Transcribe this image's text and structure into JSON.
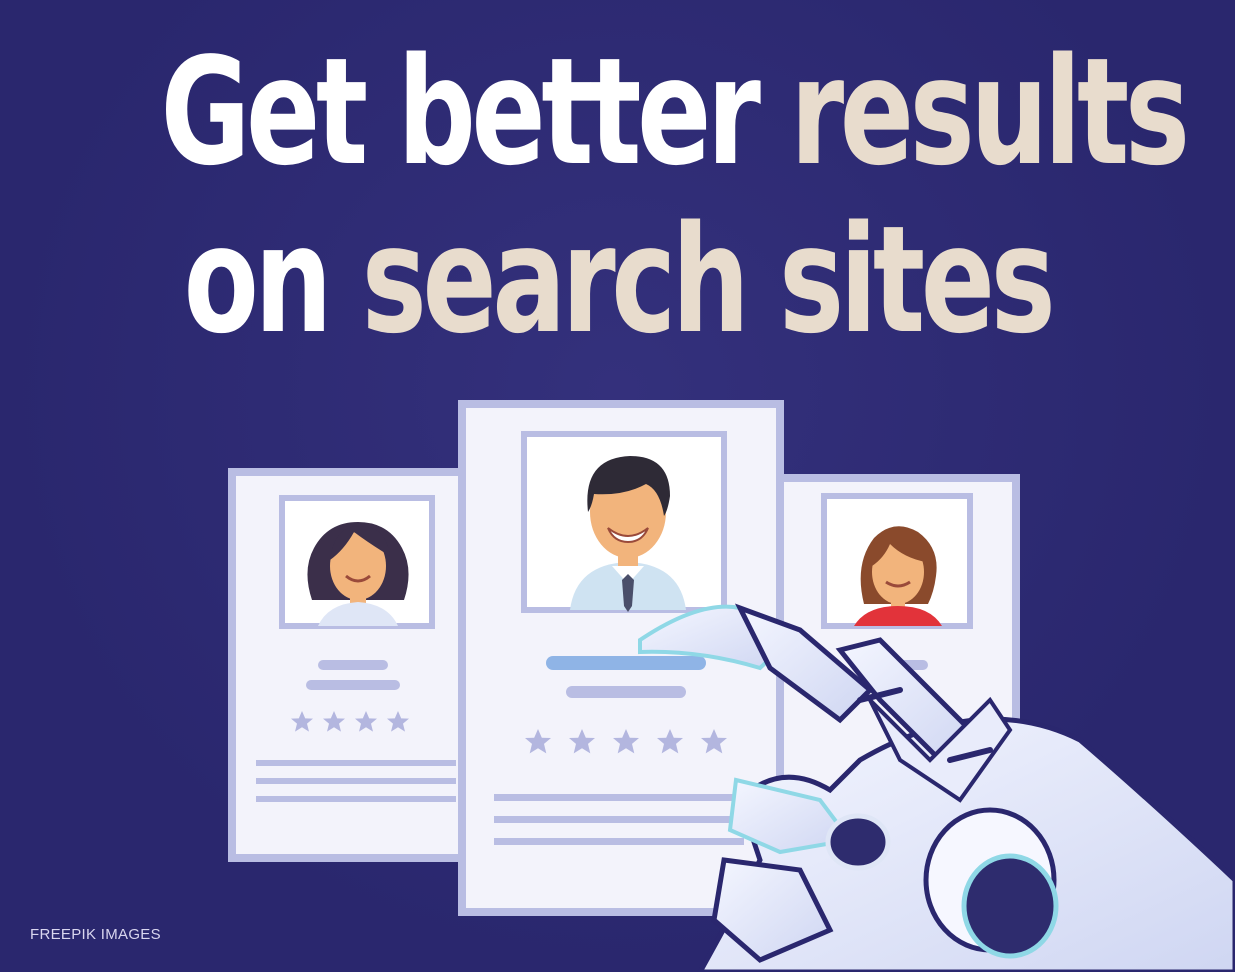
{
  "headline": {
    "line1": {
      "w1": "Get",
      "w2": "better",
      "w3": "results"
    },
    "line2": {
      "w1": "on",
      "w2": "search",
      "w3": "sites"
    }
  },
  "credit": "FREEPIK IMAGES",
  "colors": {
    "background": "#2a276e",
    "headline_white": "#ffffff",
    "headline_tan": "#e8dccd",
    "card": "#f3f3fb",
    "card_border": "#b9bde3",
    "accent_lines": "#8fb4e6"
  },
  "cards": {
    "left": {
      "rating": 4
    },
    "center": {
      "rating": 5
    },
    "right": {
      "rating": 0
    }
  },
  "icons": [
    "star-icon",
    "avatar-woman-dark-hair",
    "avatar-man-tie",
    "avatar-woman-red-top",
    "robot-hand-icon"
  ]
}
